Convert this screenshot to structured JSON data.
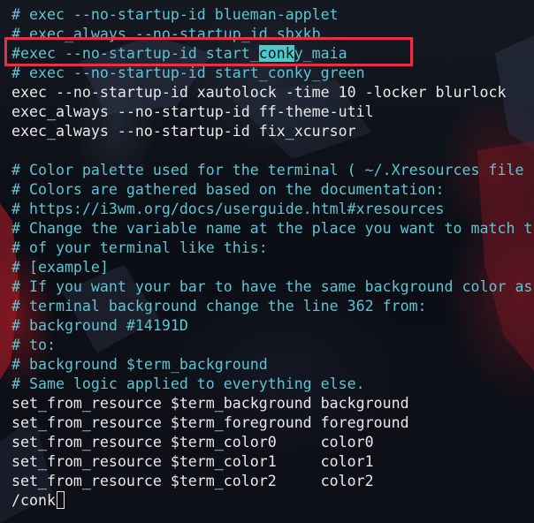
{
  "terminal": {
    "lines": [
      {
        "type": "comment",
        "text": "# exec --no-startup-id blueman-applet"
      },
      {
        "type": "comment",
        "text": "# exec_always --no-startup_id sbxkb"
      },
      {
        "type": "comment-hl",
        "pre": "#exec --no-startup-id start_",
        "hl": "conk",
        "post": "y_maia"
      },
      {
        "type": "comment",
        "text": "# exec --no-startup-id start_conky_green"
      },
      {
        "type": "code",
        "text": "exec --no-startup-id xautolock -time 10 -locker blurlock"
      },
      {
        "type": "code",
        "text": "exec_always --no-startup-id ff-theme-util"
      },
      {
        "type": "code",
        "text": "exec_always --no-startup-id fix_xcursor"
      },
      {
        "type": "blank",
        "text": ""
      },
      {
        "type": "comment",
        "text": "# Color palette used for the terminal ( ~/.Xresources file"
      },
      {
        "type": "comment",
        "text": "# Colors are gathered based on the documentation:"
      },
      {
        "type": "comment",
        "text": "# https://i3wm.org/docs/userguide.html#xresources"
      },
      {
        "type": "comment",
        "text": "# Change the variable name at the place you want to match t"
      },
      {
        "type": "comment",
        "text": "# of your terminal like this:"
      },
      {
        "type": "comment",
        "text": "# [example]"
      },
      {
        "type": "comment",
        "text": "# If you want your bar to have the same background color as"
      },
      {
        "type": "comment",
        "text": "# terminal background change the line 362 from:"
      },
      {
        "type": "comment",
        "text": "# background #14191D"
      },
      {
        "type": "comment",
        "text": "# to:"
      },
      {
        "type": "comment",
        "text": "# background $term_background"
      },
      {
        "type": "comment",
        "text": "# Same logic applied to everything else."
      },
      {
        "type": "code",
        "text": "set_from_resource $term_background background"
      },
      {
        "type": "code",
        "text": "set_from_resource $term_foreground foreground"
      },
      {
        "type": "code",
        "text": "set_from_resource $term_color0     color0"
      },
      {
        "type": "code",
        "text": "set_from_resource $term_color1     color1"
      },
      {
        "type": "code",
        "text": "set_from_resource $term_color2     color2"
      }
    ],
    "search_prompt": "/conk",
    "colors": {
      "comment": "#5fc4cf",
      "code": "#e9e9e9",
      "highlight": "#4ec9c9",
      "annotation": "#e5304a"
    }
  }
}
